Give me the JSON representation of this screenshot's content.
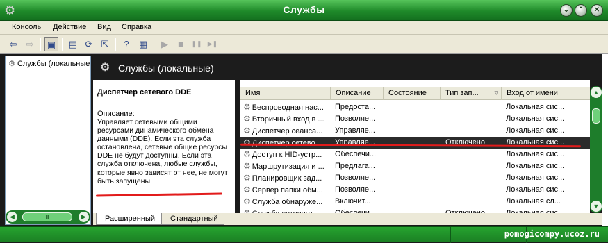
{
  "window": {
    "title": "Службы",
    "icon": "gears-icon",
    "buttons": [
      {
        "name": "minimize-button",
        "glyph": "⌄"
      },
      {
        "name": "maximize-button",
        "glyph": "⌃"
      },
      {
        "name": "close-button",
        "glyph": "✕"
      }
    ]
  },
  "menu": [
    "Консоль",
    "Действие",
    "Вид",
    "Справка"
  ],
  "toolbar": {
    "back_icon": "⇦",
    "forward_icon": "⇨",
    "show_tree_icon": "▣",
    "properties_icon": "▤",
    "refresh_icon": "⟳",
    "export_icon": "⇱",
    "help_icon": "?",
    "console_icon": "▦",
    "play_icon": "▶",
    "stop_icon": "■",
    "pause_icon": "❚❚",
    "restart_icon": "▶❚"
  },
  "tree": {
    "item_label": "Службы (локальные"
  },
  "hscroll": {
    "left": "◀",
    "right": "▶",
    "thumb": "Ⅲ"
  },
  "header": {
    "title": "Службы (локальные)"
  },
  "description": {
    "service_name": "Диспетчер сетевого DDE",
    "label": "Описание:",
    "text": "Управляет сетевыми общими ресурсами динамического обмена данными (DDE). Если эта служба остановлена, сетевые общие ресурсы DDE не будут доступны. Если эта служба отключена, любые службы, которые явно зависят от нее, не могут быть запущены."
  },
  "list": {
    "columns": [
      "Имя",
      "Описание",
      "Состояние",
      "Тип зап...",
      "Вход от имени"
    ],
    "rows": [
      {
        "name": "Беспроводная нас...",
        "desc": "Предоста...",
        "state": "",
        "start": "",
        "logon": "Локальная сис..."
      },
      {
        "name": "Вторичный вход в ...",
        "desc": "Позволяе...",
        "state": "",
        "start": "",
        "logon": "Локальная сис..."
      },
      {
        "name": "Диспетчер сеанса...",
        "desc": "Управляе...",
        "state": "",
        "start": "",
        "logon": "Локальная сис..."
      },
      {
        "name": "Диспетчер сетево...",
        "desc": "Управляе...",
        "state": "",
        "start": "Отключено",
        "logon": "Локальная сис..."
      },
      {
        "name": "Доступ к HID-устр...",
        "desc": "Обеспечи...",
        "state": "",
        "start": "",
        "logon": "Локальная сис..."
      },
      {
        "name": "Маршрутизация и ...",
        "desc": "Предлага...",
        "state": "",
        "start": "",
        "logon": "Локальная сис..."
      },
      {
        "name": "Планировщик зад...",
        "desc": "Позволяе...",
        "state": "",
        "start": "",
        "logon": "Локальная сис..."
      },
      {
        "name": "Сервер папки обм...",
        "desc": "Позволяе...",
        "state": "",
        "start": "",
        "logon": "Локальная сис..."
      },
      {
        "name": "Служба обнаруже...",
        "desc": "Включит...",
        "state": "",
        "start": "",
        "logon": "Локальная сл..."
      },
      {
        "name": "Служба сетевого ...",
        "desc": "Обеспечи...",
        "state": "",
        "start": "Отключено",
        "logon": "Локальная сис..."
      }
    ],
    "selected_index": 3
  },
  "vscroll": {
    "up": "▲",
    "down": "▼"
  },
  "tabs": [
    "Расширенный",
    "Стандартный"
  ],
  "watermark": "pomogicompy.ucoz.ru",
  "colors": {
    "theme_green": "#1e7d2b",
    "selection": "#2b2b2b",
    "annotation_red": "#e21b1b"
  }
}
